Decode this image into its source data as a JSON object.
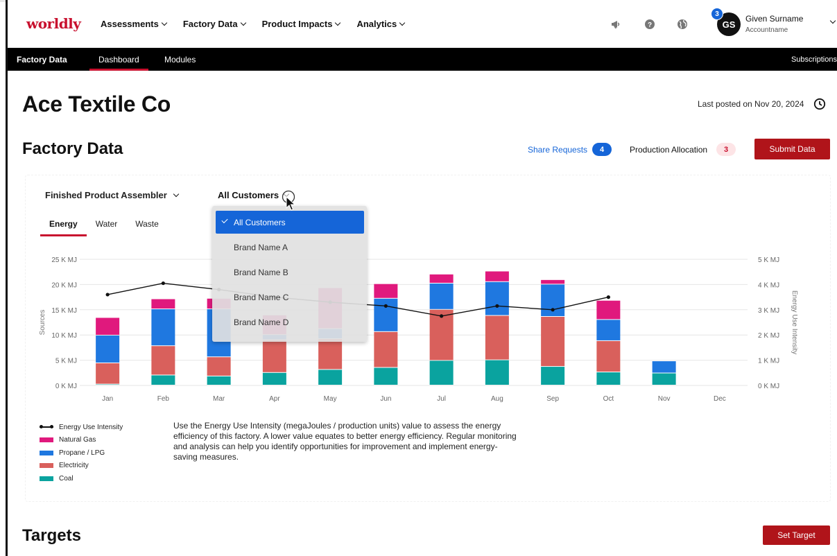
{
  "app": {
    "logo": "worldly"
  },
  "nav": {
    "items": [
      "Assessments",
      "Factory Data",
      "Product Impacts",
      "Analytics"
    ],
    "icons": [
      "megaphone-icon",
      "help-icon",
      "globe-icon"
    ],
    "notification_count": "3",
    "avatar_initials": "GS",
    "user_name": "Given Surname",
    "account_name": "Accountname"
  },
  "subnav": {
    "brand": "Factory Data",
    "tabs": [
      "Dashboard",
      "Modules"
    ],
    "active_tab": "Dashboard",
    "subscriptions": "Subscriptions"
  },
  "page": {
    "title": "Ace Textile Co",
    "last_posted": "Last posted on Nov 20, 2024"
  },
  "factory_data": {
    "title": "Factory Data",
    "share_requests_label": "Share Requests",
    "share_requests_count": "4",
    "production_allocation_label": "Production Allocation",
    "production_allocation_count": "3",
    "submit_label": "Submit Data"
  },
  "filters": {
    "role": "Finished Product Assembler",
    "customer": "All Customers"
  },
  "dropdown": {
    "options": [
      "All Customers",
      "Brand Name A",
      "Brand Name B",
      "Brand Name C",
      "Brand Name D"
    ],
    "selected": "All Customers"
  },
  "chart_tabs": [
    "Energy",
    "Water",
    "Waste"
  ],
  "active_chart_tab": "Energy",
  "chart_data": {
    "type": "bar",
    "stacked": true,
    "categories": [
      "Jan",
      "Feb",
      "Mar",
      "Apr",
      "May",
      "Jun",
      "Jul",
      "Aug",
      "Sep",
      "Oct",
      "Nov",
      "Dec"
    ],
    "series": [
      {
        "name": "Coal",
        "color": "#0aa39f",
        "values": [
          200,
          2000,
          1800,
          2500,
          3100,
          3500,
          4900,
          5000,
          3700,
          2600,
          2400,
          0
        ]
      },
      {
        "name": "Electricity",
        "color": "#d9605c",
        "values": [
          4200,
          5800,
          3800,
          6500,
          6100,
          7100,
          10100,
          8800,
          9900,
          6200,
          0,
          0
        ]
      },
      {
        "name": "Propane / LPG",
        "color": "#1f78e0",
        "values": [
          5500,
          7300,
          9500,
          1000,
          2000,
          6600,
          5200,
          6700,
          6400,
          4200,
          2400,
          0
        ]
      },
      {
        "name": "Natural Gas",
        "color": "#e0197d",
        "values": [
          3500,
          2000,
          2100,
          3900,
          8100,
          2900,
          1800,
          2100,
          900,
          3800,
          0,
          0
        ]
      }
    ],
    "line_series": {
      "name": "Energy Use Intensity",
      "color": "#111111",
      "values": [
        3.6,
        4.05,
        3.8,
        3.5,
        3.3,
        3.15,
        2.75,
        3.15,
        3.0,
        3.5,
        null,
        null
      ]
    },
    "ylabel": "Sources",
    "y2label": "Energy Use Intensity",
    "yticks": [
      "0 K MJ",
      "5 K MJ",
      "10 K MJ",
      "15 K MJ",
      "20 K MJ",
      "25 K MJ"
    ],
    "y2ticks": [
      "0 K MJ",
      "1 K MJ",
      "2 K MJ",
      "3 K MJ",
      "4 K MJ",
      "5 K MJ"
    ],
    "ylim": [
      0,
      25000
    ],
    "y2lim": [
      0,
      5
    ],
    "grid": true
  },
  "legend": [
    "Energy Use Intensity",
    "Natural Gas",
    "Propane / LPG",
    "Electricity",
    "Coal"
  ],
  "description": "Use the Energy Use Intensity (megaJoules / production units) value to assess the energy efficiency of this factory. A lower value equates to better energy efficiency. Regular monitoring and analysis can help you identify opportunities for improvement and implement energy-saving measures.",
  "targets": {
    "title": "Targets",
    "set_target_label": "Set Target"
  }
}
